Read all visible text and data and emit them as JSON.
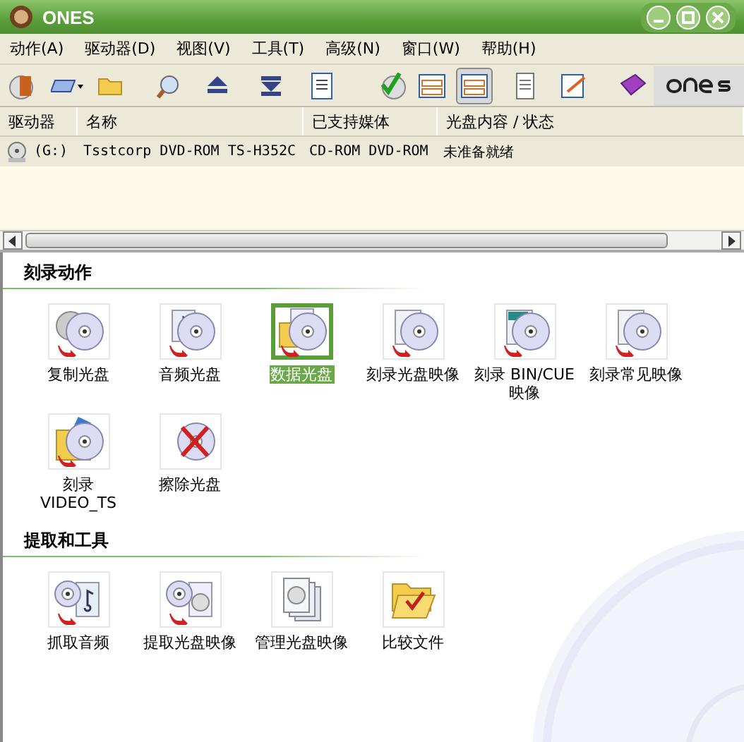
{
  "window": {
    "title": "ONES"
  },
  "menu": [
    "动作(A)",
    "驱动器(D)",
    "视图(V)",
    "工具(T)",
    "高级(N)",
    "窗口(W)",
    "帮助(H)"
  ],
  "toolbar": [
    {
      "selected": false
    },
    {
      "selected": false
    },
    {
      "selected": false
    },
    {
      "selected": false
    },
    {
      "selected": false
    },
    {
      "selected": false
    },
    {
      "selected": false
    },
    {
      "selected": false
    },
    {
      "selected": false
    },
    {
      "selected": true
    },
    {
      "selected": false
    },
    {
      "selected": false
    },
    {
      "selected": false
    }
  ],
  "drives": {
    "columns": [
      "驱动器",
      "名称",
      "已支持媒体",
      "光盘内容 / 状态"
    ],
    "rows": [
      {
        "drive": "(G:)",
        "name": "Tsstcorp DVD-ROM TS-H352C",
        "media": "CD-ROM DVD-ROM",
        "status": "未准备就绪"
      }
    ]
  },
  "sections": [
    {
      "title": "刻录动作",
      "items": [
        {
          "label": "复制光盘",
          "selected": false
        },
        {
          "label": "音频光盘",
          "selected": false
        },
        {
          "label": "数据光盘",
          "selected": true
        },
        {
          "label": "刻录光盘映像",
          "selected": false
        },
        {
          "label": "刻录 BIN/CUE 映像",
          "selected": false
        },
        {
          "label": "刻录常见映像",
          "selected": false
        },
        {
          "label": "刻录 VIDEO_TS",
          "selected": false
        },
        {
          "label": "擦除光盘",
          "selected": false
        }
      ]
    },
    {
      "title": "提取和工具",
      "items": [
        {
          "label": "抓取音频",
          "selected": false
        },
        {
          "label": "提取光盘映像",
          "selected": false
        },
        {
          "label": "管理光盘映像",
          "selected": false
        },
        {
          "label": "比较文件",
          "selected": false
        }
      ]
    }
  ]
}
